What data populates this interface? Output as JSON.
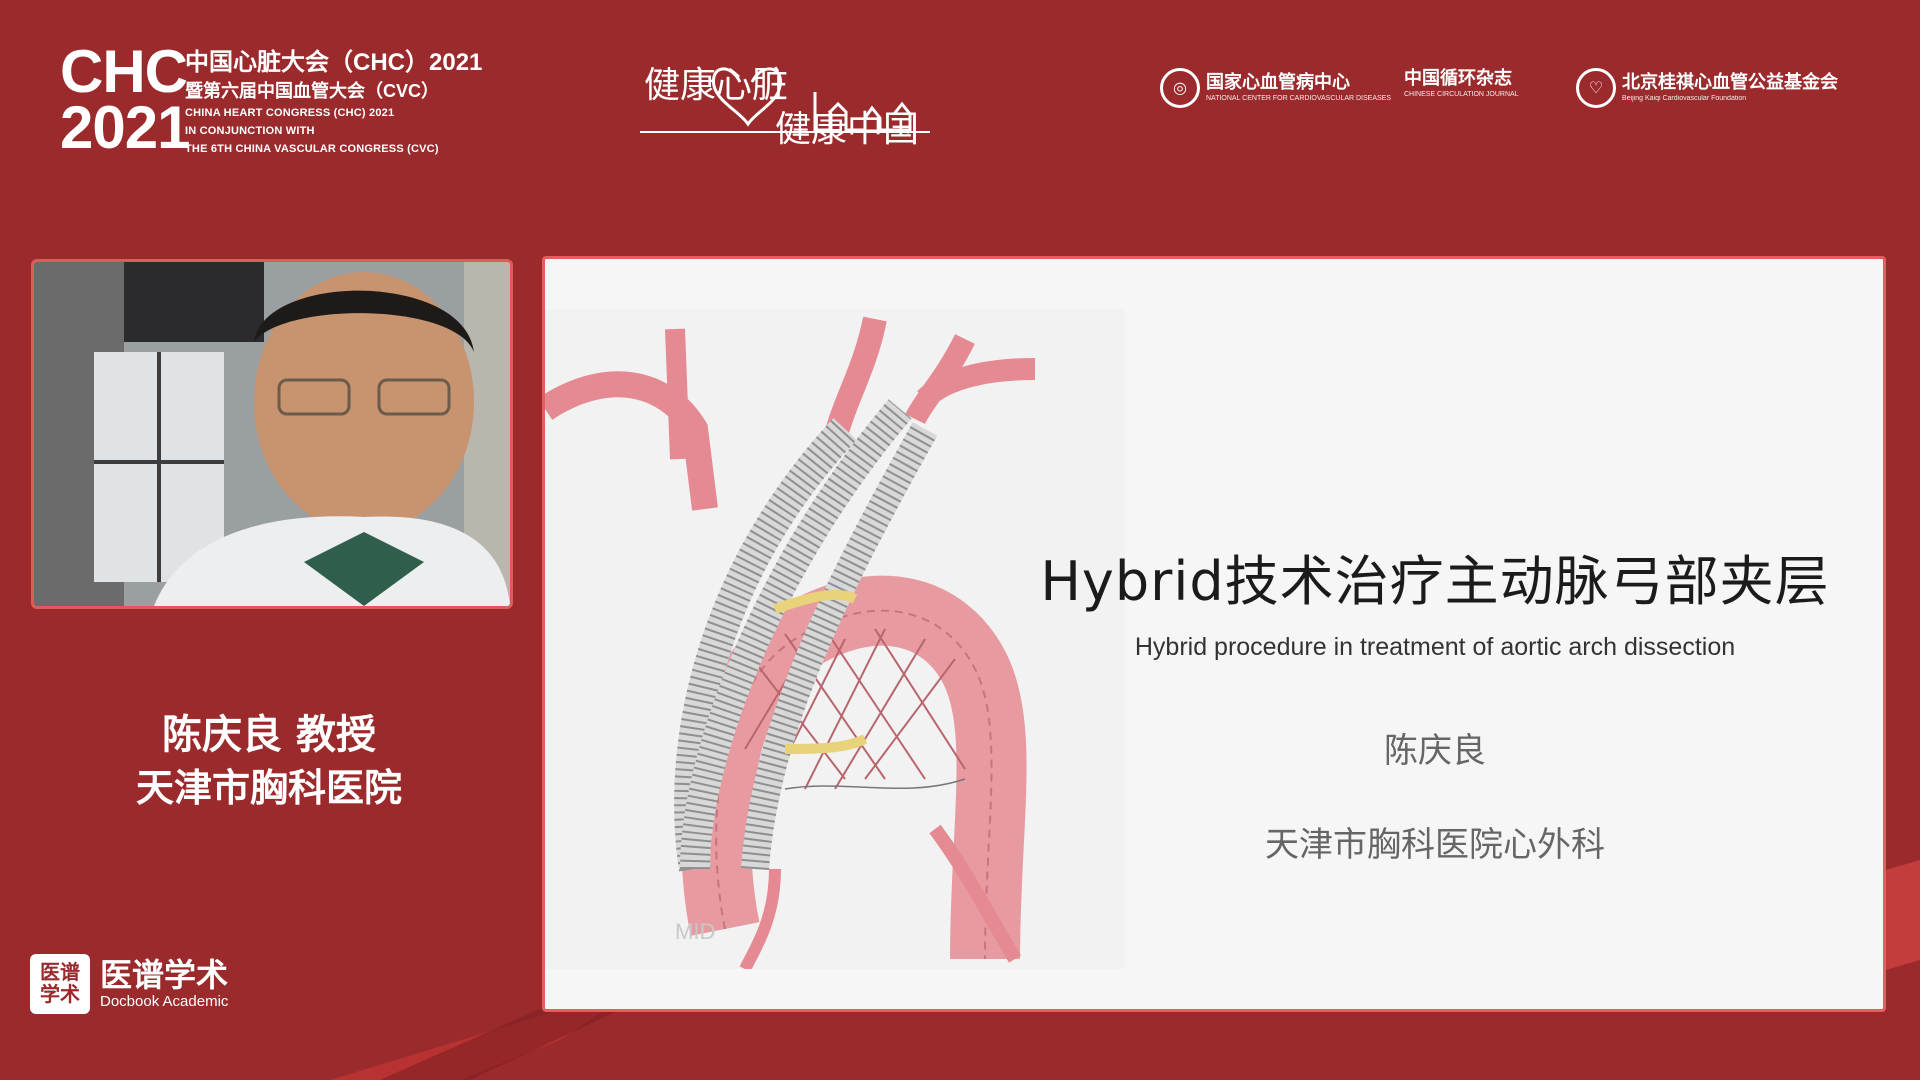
{
  "header": {
    "chc_mark_line1": "CHC",
    "chc_mark_line2": "2021",
    "cn_line1": "中国心脏大会（CHC）2021",
    "cn_line2": "暨第六届中国血管大会（CVC）",
    "en_line1": "CHINA HEART CONGRESS (CHC) 2021",
    "en_line2": "IN CONJUNCTION WITH",
    "en_line3": "THE 6TH CHINA VASCULAR CONGRESS (CVC)",
    "slogan_line1": "健康心脏",
    "slogan_line2": "健康中国",
    "orgs": [
      {
        "cn": "国家心血管病中心",
        "en": "NATIONAL CENTER FOR CARDIOVASCULAR DISEASES"
      },
      {
        "cn": "中国循环杂志",
        "en": "CHINESE CIRCULATION JOURNAL"
      },
      {
        "cn": "北京桂祺心血管公益基金会",
        "en": "Beijing Kaiqi Cardiovascular Foundation"
      }
    ]
  },
  "speaker": {
    "name_title": "陈庆良 教授",
    "hospital": "天津市胸科医院"
  },
  "brand": {
    "icon_top": "医谱",
    "icon_bottom": "学术",
    "cn": "医谱学术",
    "en": "Docbook Academic"
  },
  "slide": {
    "title": "Hybrid技术治疗主动脉弓部夹层",
    "subtitle": "Hybrid procedure in treatment of aortic arch dissection",
    "author": "陈庆良",
    "department": "天津市胸科医院心外科",
    "illustration_mark": "MID"
  },
  "colors": {
    "background": "#9b2a2c",
    "accent_border": "#e35e5e",
    "slide_bg": "#f6f6f7"
  }
}
